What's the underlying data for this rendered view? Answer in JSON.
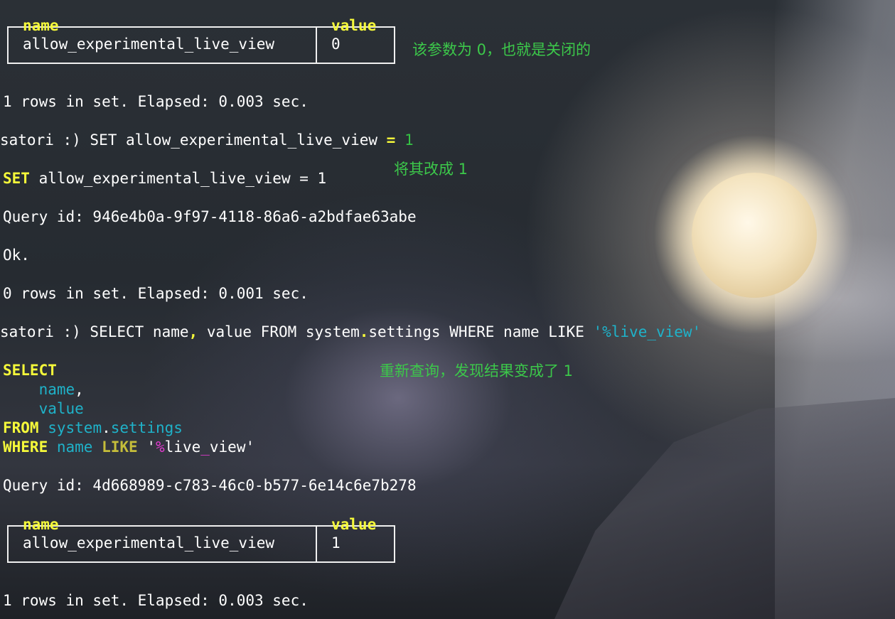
{
  "table1": {
    "header_name": "name",
    "header_value": "value",
    "row_name": "allow_experimental_live_view",
    "row_value": "0"
  },
  "note1": "该参数为 0，也就是关闭的",
  "line_rows1": "1 rows in set. Elapsed: 0.003 sec.",
  "cmd1": {
    "prompt": "satori :) SET allow_experimental_live_view ",
    "eq": "=",
    "val": "1"
  },
  "echo1": {
    "kw": "SET",
    "rest": " allow_experimental_live_view = 1"
  },
  "note2": "将其改成 1",
  "query_id1": "Query id: 946e4b0a-9f97-4118-86a6-a2bdfae63abe",
  "ok": "Ok.",
  "line_rows0": "0 rows in set. Elapsed: 0.001 sec.",
  "cmd2": {
    "prompt": "satori :) SELECT name",
    "comma": ",",
    "mid": " value FROM system",
    "dot": ".",
    "tail": "settings WHERE name LIKE ",
    "str": "'%live_view'"
  },
  "note3": "重新查询，发现结果变成了 1",
  "formatted": {
    "select": "SELECT",
    "name": "name",
    "comma": ",",
    "value": "value",
    "from": "FROM",
    "system": "system",
    "dot": ".",
    "settings": "settings",
    "where": "WHERE",
    "name2": "name",
    "like": "LIKE",
    "q1": "'",
    "pct": "%",
    "live": "live",
    "us": "_",
    "view": "view",
    "q2": "'"
  },
  "query_id2": "Query id: 4d668989-c783-46c0-b577-6e14c6e7b278",
  "table2": {
    "header_name": "name",
    "header_value": "value",
    "row_name": "allow_experimental_live_view",
    "row_value": "1"
  },
  "line_rows2": "1 rows in set. Elapsed: 0.003 sec."
}
